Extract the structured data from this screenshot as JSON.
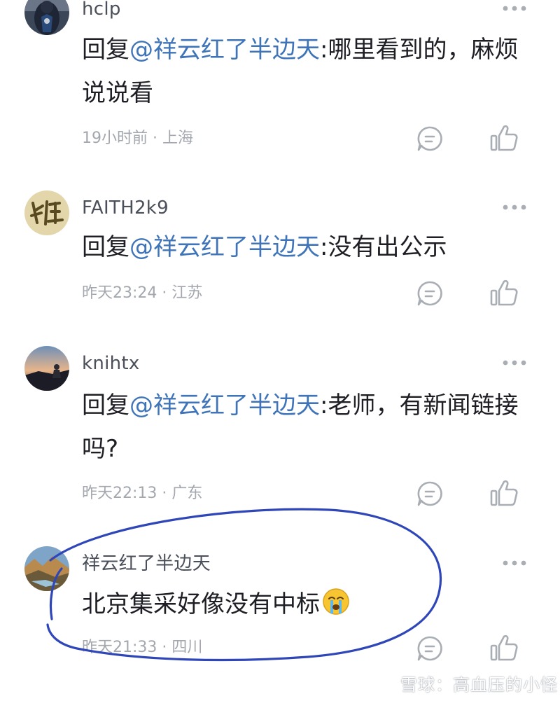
{
  "comments": [
    {
      "username": "hclp",
      "reply_prefix": "回复",
      "mention": "@祥云红了半边天",
      "text_line1": ":哪里看到的，麻烦",
      "text_line2": "说说看",
      "meta": "19小时前 · 上海",
      "avatar_icon": "superhero-avatar"
    },
    {
      "username": "FAITH2k9",
      "reply_prefix": "回复",
      "mention": "@祥云红了半边天",
      "text_line1": ":没有出公示",
      "meta": "昨天23:24 · 江苏",
      "avatar_icon": "calligraphy-avatar"
    },
    {
      "username": "knihtx",
      "reply_prefix": "回复",
      "mention": "@祥云红了半边天",
      "text_line1": ":老师，有新闻链接",
      "text_line2": "吗?",
      "meta": "昨天22:13 · 广东",
      "avatar_icon": "sunset-avatar"
    },
    {
      "username": "祥云红了半边天",
      "text_line1": "北京集采好像没有中标",
      "emoji": "crying-face-emoji",
      "meta": "昨天21:33 · 四川",
      "avatar_icon": "landscape-avatar"
    }
  ],
  "watermark": {
    "text": "雪球：高血压的小怪"
  },
  "colors": {
    "mention": "#3f74b8",
    "body_text": "#1e1f24",
    "meta_text": "#a3a7ae",
    "icon_gray": "#a9adb4",
    "annotation_circle": "#2f46b8"
  }
}
